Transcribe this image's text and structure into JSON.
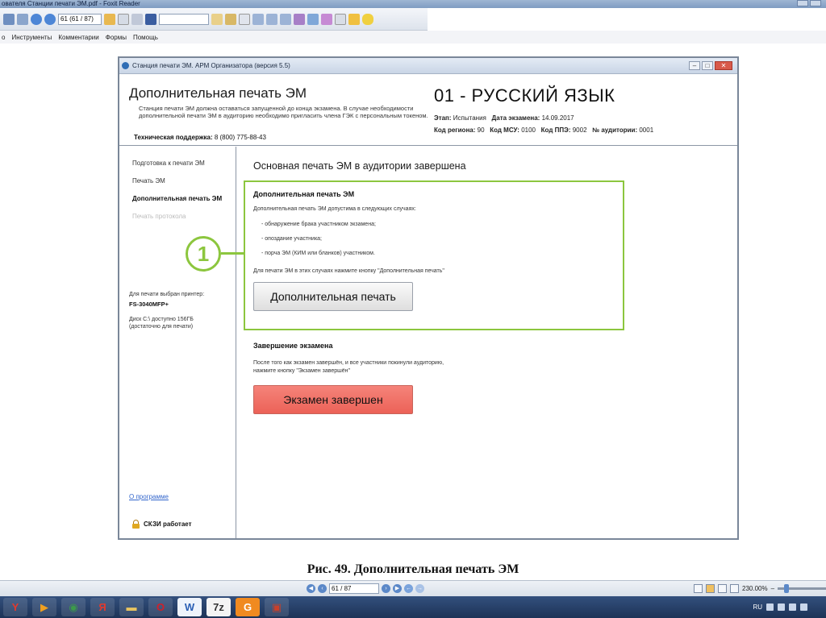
{
  "reader": {
    "window_title": "ователя Станции печати ЭМ.pdf - Foxit Reader",
    "toolbar_page_field": "61 (61 / 87)",
    "menu": [
      "о",
      "Инструменты",
      "Комментарии",
      "Формы",
      "Помощь"
    ]
  },
  "app": {
    "window_title": "Станция печати ЭМ. АРМ Организатора (версия 5.5)",
    "header": {
      "title": "Дополнительная печать ЭМ",
      "description": "Станция печати ЭМ должна оставаться запущенной до конца экзамена. В случае необходимости дополнительной печати ЭМ в аудиторию необходимо пригласить члена ГЭК с персональным токеном.",
      "support_label": "Техническая поддержка:",
      "support_phone": "8 (800) 775-88-43",
      "subject": "01 - РУССКИЙ ЯЗЫК",
      "stage_label": "Этап:",
      "stage_value": "Испытания",
      "date_label": "Дата экзамена:",
      "date_value": "14.09.2017",
      "region_label": "Код региона:",
      "region_value": "90",
      "msu_label": "Код МСУ:",
      "msu_value": "0100",
      "ppe_label": "Код ППЭ:",
      "ppe_value": "9002",
      "room_label": "№ аудитории:",
      "room_value": "0001"
    },
    "sidebar": {
      "items": [
        {
          "label": "Подготовка к печати ЭМ",
          "state": "normal"
        },
        {
          "label": "Печать ЭМ",
          "state": "normal"
        },
        {
          "label": "Дополнительная печать ЭМ",
          "state": "active"
        },
        {
          "label": "Печать протокола",
          "state": "disabled"
        }
      ],
      "printer_label": "Для печати выбран принтер:",
      "printer_name": "FS-3040MFP+",
      "disk_info": "Диск C:\\ доступно 156ГБ (достаточно для печати)",
      "about_link": "О программе",
      "skzi_status": "СКЗИ работает"
    },
    "main": {
      "status_heading": "Основная печать ЭМ в аудитории завершена",
      "extra_print": {
        "title": "Дополнительная печать ЭМ",
        "intro": "Дополнительная печать ЭМ допустима в следующих случаях:",
        "cases": [
          "- обнаружение брака участником экзамена;",
          "- опоздание участника;",
          "- порча ЭМ (КИМ или бланков)  участником."
        ],
        "hint": "Для печати ЭМ в этих случаях нажмите кнопку \"Дополнительная печать\"",
        "button_label": "Дополнительная печать"
      },
      "finish": {
        "title": "Завершение экзамена",
        "description": "После того как экзамен завершён, и все участники покинули аудиторию, нажмите кнопку \"Экзамен завершён\"",
        "button_label": "Экзамен завершен"
      }
    }
  },
  "annotation": {
    "callout_number": "1",
    "accent_color": "#8cc63e"
  },
  "caption": "Рис. 49. Дополнительная печать ЭМ",
  "statusbar": {
    "page_field": "61 / 87",
    "zoom": "230.00%"
  },
  "taskbar": {
    "apps": [
      {
        "icon": "yandex-icon",
        "glyph": "Y",
        "color": "#e23a2e"
      },
      {
        "icon": "media-player-icon",
        "glyph": "▶",
        "color": "#f0a020"
      },
      {
        "icon": "chrome-icon",
        "glyph": "◉",
        "color": "#3c9a4a"
      },
      {
        "icon": "yandex-browser-icon",
        "glyph": "Я",
        "color": "#e23a2e"
      },
      {
        "icon": "folder-icon",
        "glyph": "▬",
        "color": "#e8c460"
      },
      {
        "icon": "opera-icon",
        "glyph": "O",
        "color": "#d0202a"
      },
      {
        "icon": "word-icon",
        "glyph": "W",
        "color": "#2b5fb4"
      },
      {
        "icon": "7zip-icon",
        "glyph": "7z",
        "color": "#333333"
      },
      {
        "icon": "foxit-icon",
        "glyph": "G",
        "color": "#f08a20"
      },
      {
        "icon": "pdf-icon",
        "glyph": "▣",
        "color": "#c8402a"
      }
    ],
    "lang": "RU"
  }
}
